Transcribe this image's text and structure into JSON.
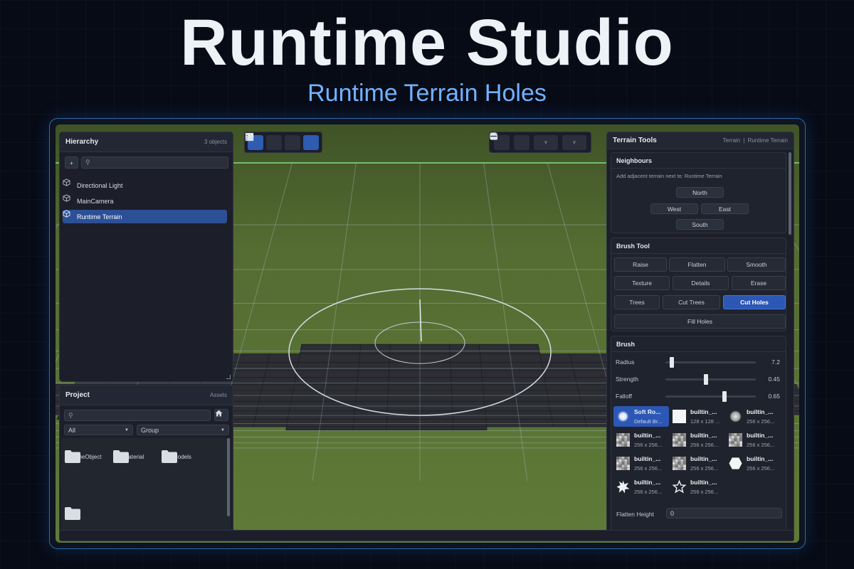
{
  "hero": {
    "title": "Runtime Studio",
    "subtitle": "Runtime Terrain Holes"
  },
  "hierarchy": {
    "title": "Hierarchy",
    "count": "3 objects",
    "add_label": "+",
    "items": [
      {
        "label": "Directional Light",
        "icon": "cube-icon",
        "selected": false
      },
      {
        "label": "MainCamera",
        "icon": "cube-icon",
        "selected": false
      },
      {
        "label": "Runtime Terrain",
        "icon": "cube-icon",
        "selected": true
      }
    ]
  },
  "project": {
    "title": "Project",
    "meta": "Assets",
    "filter_value": "All",
    "group_value": "Group",
    "folders": [
      {
        "label": "GameObject"
      },
      {
        "label": "Material"
      },
      {
        "label": "Models"
      },
      {
        "label": ""
      }
    ]
  },
  "toolbar": {
    "left_tools": [
      "move-icon",
      "rotate-icon",
      "scale-icon",
      "terrain-tool-icon"
    ],
    "right_tools": [
      "play-icon",
      "toolbox-icon",
      "gizmo-icon",
      "sphere-icon"
    ],
    "caret": "v"
  },
  "terrain_tools": {
    "title": "Terrain Tools",
    "breadcrumb_a": "Terrain",
    "breadcrumb_sep": "|",
    "breadcrumb_b": "Runtime Terrain",
    "neighbours": {
      "title": "Neighbours",
      "hint": "Add adjacent terrain next to: Runtime Terrain",
      "north": "North",
      "west": "West",
      "east": "East",
      "south": "South"
    },
    "brush_tool": {
      "title": "Brush Tool",
      "row1": [
        "Raise",
        "Flatten",
        "Smooth"
      ],
      "row2": [
        "Texture",
        "Details",
        "Erase"
      ],
      "row3": [
        "Trees",
        "Cut Trees",
        "Cut Holes"
      ],
      "fill": "Fill Holes",
      "active": "Cut Holes"
    },
    "brush": {
      "title": "Brush",
      "radius_label": "Radius",
      "radius_value": "7.2",
      "radius_fraction": 0.07,
      "strength_label": "Strength",
      "strength_value": "0.45",
      "strength_fraction": 0.45,
      "falloff_label": "Falloff",
      "falloff_value": "0.65",
      "falloff_fraction": 0.65,
      "items": [
        {
          "name": "Soft Ro...",
          "size": "Default Br...",
          "selected": true
        },
        {
          "name": "builtin_...",
          "size": "128 x 128 ..."
        },
        {
          "name": "builtin_...",
          "size": "256 x 256..."
        },
        {
          "name": "builtin_...",
          "size": "256 x 256..."
        },
        {
          "name": "builtin_...",
          "size": "256 x 256..."
        },
        {
          "name": "builtin_...",
          "size": "256 x 256..."
        },
        {
          "name": "builtin_...",
          "size": "256 x 256..."
        },
        {
          "name": "builtin_...",
          "size": "256 x 256..."
        },
        {
          "name": "builtin_...",
          "size": "256 x 256..."
        },
        {
          "name": "builtin_...",
          "size": "256 x 256..."
        },
        {
          "name": "builtin_...",
          "size": "256 x 256..."
        }
      ],
      "flatten_label": "Flatten Height",
      "flatten_value": "0"
    }
  },
  "colors": {
    "accent": "#2c57b4",
    "terrain": "#586f35",
    "hole": "#2c2e33",
    "title_blue": "#73b2ff"
  }
}
